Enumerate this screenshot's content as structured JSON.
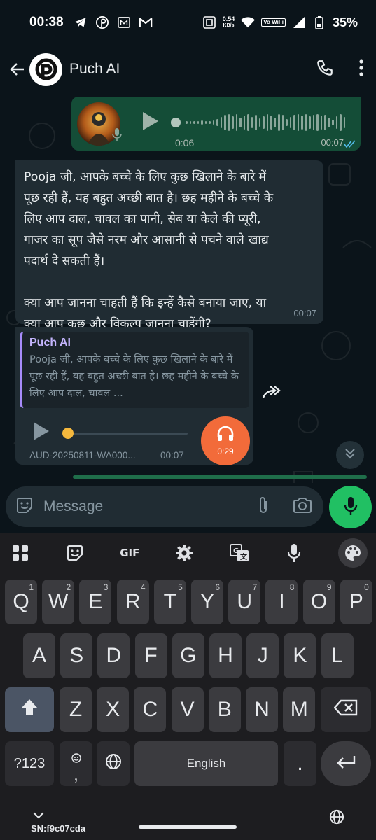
{
  "status_bar": {
    "time": "00:38",
    "net_speed": "0.54",
    "net_unit": "KB/s",
    "volte": "Vo WiFi",
    "battery": "35%"
  },
  "header": {
    "title": "Puch AI",
    "icons": [
      "back-arrow-icon",
      "phone-icon",
      "more-vert-icon"
    ]
  },
  "chat": {
    "outgoing_voice": {
      "duration": "0:06",
      "time": "00:07",
      "status": "read"
    },
    "incoming_text": {
      "text": "Pooja जी, आपके बच्चे के लिए कुछ खिलाने के बारे में\nपूछ रही हैं, यह बहुत अच्छी बात है। छह महीने के बच्चे के\nलिए आप दाल, चावल का पानी, सेब या केले की प्यूरी,\nगाजर का सूप जैसे नरम और आसानी से पचने वाले खाद्य\nपदार्थ दे सकती हैं।\n\nक्या आप जानना चाहती हैं कि इन्हें कैसे बनाया जाए, या\nक्या आप कुछ और विकल्प जानना चाहेंगी?",
      "time": "00:07"
    },
    "reply_audio": {
      "quote_name": "Puch AI",
      "quote_text": "Pooja जी, आपके बच्चे के लिए कुछ खिलाने के बारे में पूछ रही हैं, यह बहुत अच्छी बात है। छह महीने के बच्चे के लिए आप दाल, चावल ...",
      "file_name": "AUD-20250811-WA000...",
      "duration": "00:07",
      "headset_duration": "0:29"
    }
  },
  "composer": {
    "placeholder": "Message"
  },
  "keyboard": {
    "toolbar": [
      "apps-grid-icon",
      "sticker-icon",
      "GIF",
      "settings-icon",
      "translate-icon",
      "mic-icon",
      "palette-icon"
    ],
    "gif_label": "GIF",
    "row1": [
      {
        "k": "Q",
        "n": "1"
      },
      {
        "k": "W",
        "n": "2"
      },
      {
        "k": "E",
        "n": "3"
      },
      {
        "k": "R",
        "n": "4"
      },
      {
        "k": "T",
        "n": "5"
      },
      {
        "k": "Y",
        "n": "6"
      },
      {
        "k": "U",
        "n": "7"
      },
      {
        "k": "I",
        "n": "8"
      },
      {
        "k": "O",
        "n": "9"
      },
      {
        "k": "P",
        "n": "0"
      }
    ],
    "row2": [
      "A",
      "S",
      "D",
      "F",
      "G",
      "H",
      "J",
      "K",
      "L"
    ],
    "row3": [
      "Z",
      "X",
      "C",
      "V",
      "B",
      "N",
      "M"
    ],
    "sym_label": "?123",
    "comma_label": ",",
    "space_label": "English",
    "period_label": ".",
    "serial": "SN:f9c07cda"
  },
  "colors": {
    "background": "#0b141a",
    "outgoing_bubble": "#144d37",
    "incoming_bubble": "#202c33",
    "accent_green": "#21c063",
    "headset_orange": "#f26b3a",
    "quote_bar": "#a78bfa"
  }
}
